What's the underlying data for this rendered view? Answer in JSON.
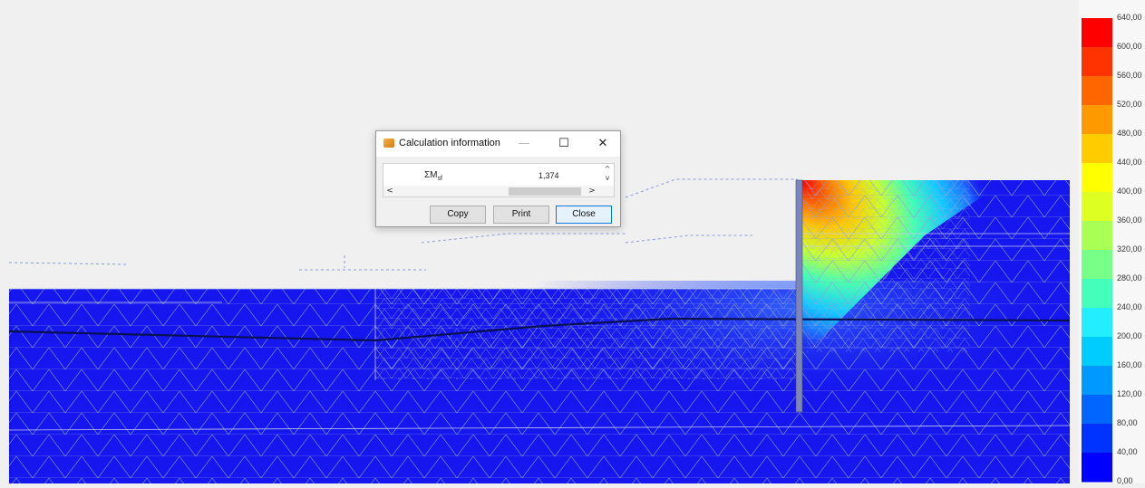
{
  "dialog": {
    "title": "Calculation information",
    "controls": {
      "minimize": "—",
      "maximize": "☐",
      "close": "✕"
    },
    "row": {
      "label_main": "ΣM",
      "label_sub": "sf",
      "value": "1,374"
    },
    "scroll": {
      "left": "<",
      "right": ">",
      "up": "^",
      "down": "v"
    },
    "buttons": {
      "copy": "Copy",
      "print": "Print",
      "close": "Close"
    }
  },
  "legend": {
    "labels": [
      "640,00",
      "600,00",
      "560,00",
      "520,00",
      "480,00",
      "440,00",
      "400,00",
      "360,00",
      "320,00",
      "280,00",
      "240,00",
      "200,00",
      "160,00",
      "120,00",
      "80,00",
      "40,00",
      "0,00"
    ],
    "colors": [
      "#ff0000",
      "#ff3300",
      "#ff6600",
      "#ff9900",
      "#ffcc00",
      "#ffff00",
      "#ddff22",
      "#aaff55",
      "#77ff88",
      "#44ffbb",
      "#22eeff",
      "#00ccff",
      "#0099ff",
      "#0066ff",
      "#0033ff",
      "#0000ff"
    ]
  },
  "colors": {
    "soil_base": "#1616ee",
    "background": "#f0f0f0"
  }
}
